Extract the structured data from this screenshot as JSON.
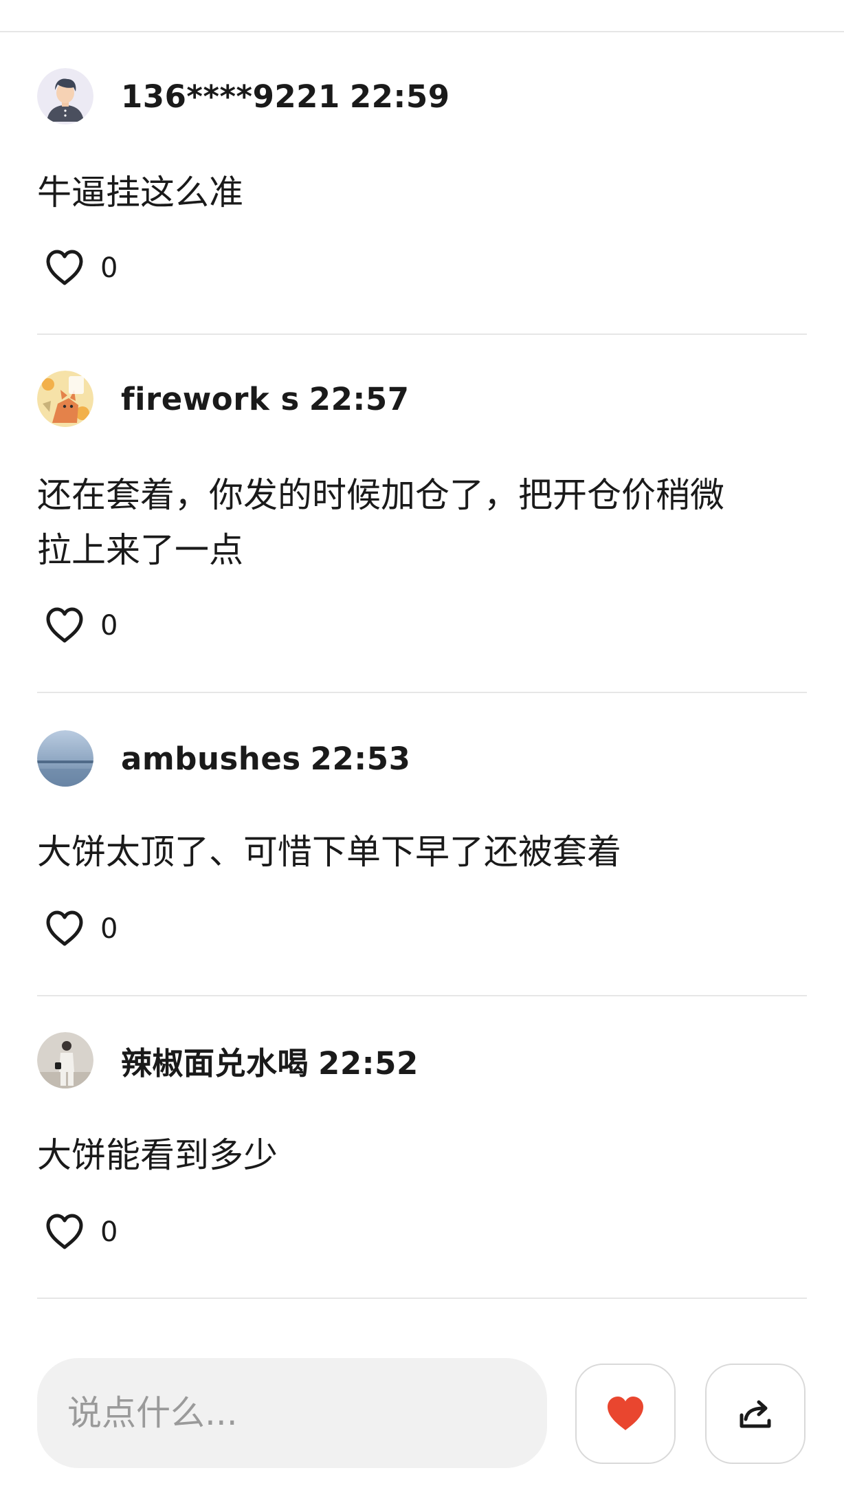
{
  "colors": {
    "accent_red": "#e9462f",
    "divider": "#e6e6e6",
    "input_bg": "#f1f1f1"
  },
  "comments": [
    {
      "user": "136****9221",
      "time": "22:59",
      "text_lines": [
        "牛逼挂这么准"
      ],
      "likes": "0",
      "avatar": "avatar-cartoon-man"
    },
    {
      "user": "firework s",
      "time": "22:57",
      "text_lines": [
        "还在套着，你发的时候加仓了，把开仓价稍微",
        "拉上来了一点"
      ],
      "likes": "0",
      "avatar": "avatar-cartoon-fox"
    },
    {
      "user": "ambushes",
      "time": "22:53",
      "text_lines": [
        "大饼太顶了、可惜下单下早了还被套着"
      ],
      "likes": "0",
      "avatar": "avatar-sky-photo"
    },
    {
      "user": "辣椒面兑水喝",
      "time": "22:52",
      "text_lines": [
        "大饼能看到多少"
      ],
      "likes": "0",
      "avatar": "avatar-person-photo"
    }
  ],
  "bottom_bar": {
    "input_placeholder": "说点什么...",
    "like_icon": "heart-icon",
    "share_icon": "share-icon"
  }
}
